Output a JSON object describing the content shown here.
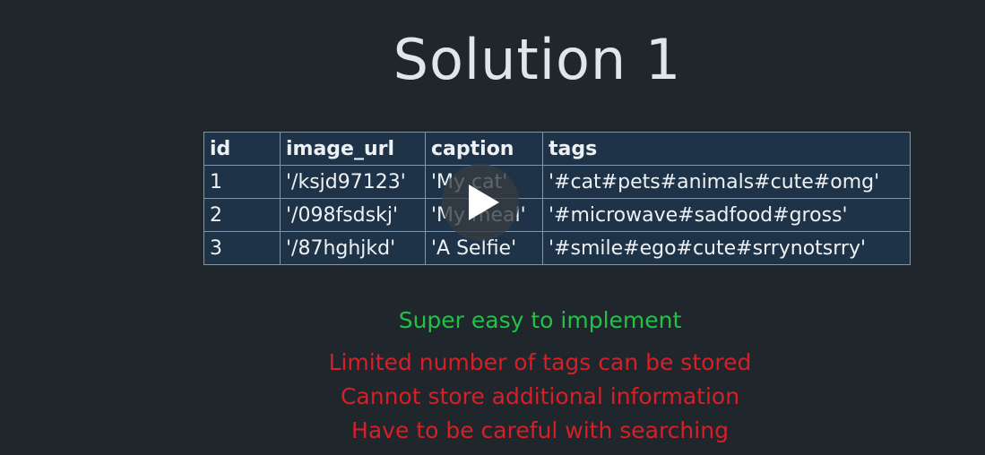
{
  "slide": {
    "title": "Solution 1"
  },
  "table": {
    "headers": [
      "id",
      "image_url",
      "caption",
      "tags"
    ],
    "rows": [
      [
        "1",
        "'/ksjd97123'",
        "'My cat'",
        "'#cat#pets#animals#cute#omg'"
      ],
      [
        "2",
        "'/098fsdskj'",
        "'My meal'",
        "'#microwave#sadfood#gross'"
      ],
      [
        "3",
        "'/87hghjkd'",
        "'A Selfie'",
        "'#smile#ego#cute#srrynotsrry'"
      ]
    ]
  },
  "notes": {
    "pros": [
      "Super easy to implement"
    ],
    "cons": [
      "Limited number of tags can be stored",
      "Cannot store additional information",
      "Have to be careful with searching"
    ]
  },
  "colors": {
    "background": "#1f272d",
    "table_cell": "#1e3347",
    "table_border": "#7f96ad",
    "pro_text": "#22c244",
    "con_text": "#d61f26"
  },
  "icons": {
    "play": "play-icon"
  }
}
